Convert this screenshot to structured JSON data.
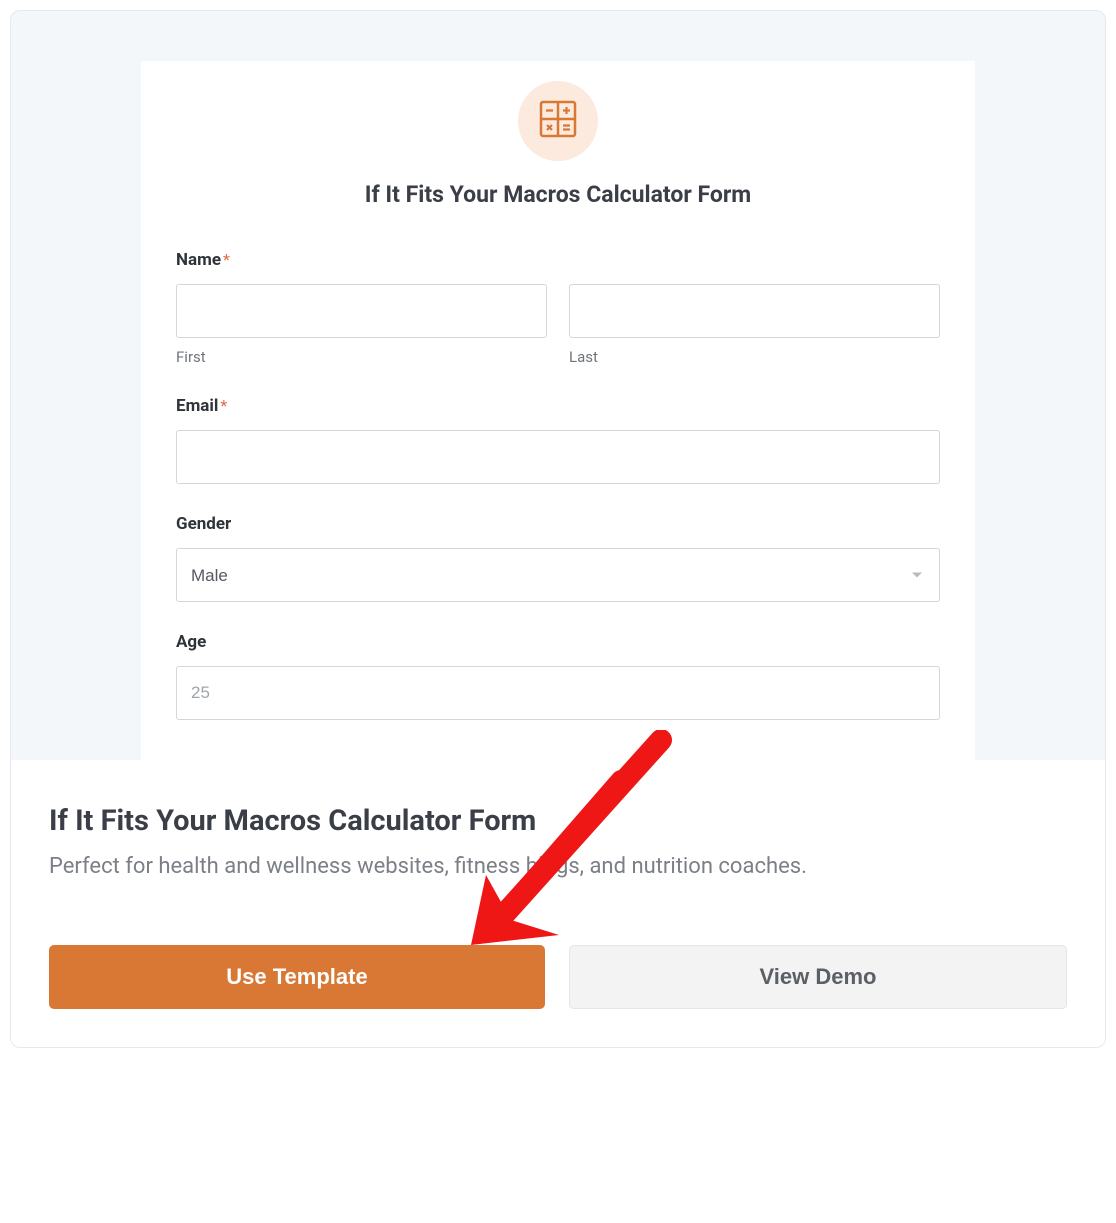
{
  "form": {
    "title": "If It Fits Your Macros Calculator Form",
    "name": {
      "label": "Name",
      "first_sub": "First",
      "last_sub": "Last"
    },
    "email": {
      "label": "Email"
    },
    "gender": {
      "label": "Gender",
      "selected": "Male"
    },
    "age": {
      "label": "Age",
      "placeholder": "25"
    },
    "required_mark": "*"
  },
  "template": {
    "name": "If It Fits Your Macros Calculator Form",
    "description": "Perfect for health and wellness websites, fitness blogs, and nutrition coaches."
  },
  "buttons": {
    "use_template": "Use Template",
    "view_demo": "View Demo"
  },
  "colors": {
    "accent": "#d87834",
    "icon_bg": "#fbeadd"
  }
}
